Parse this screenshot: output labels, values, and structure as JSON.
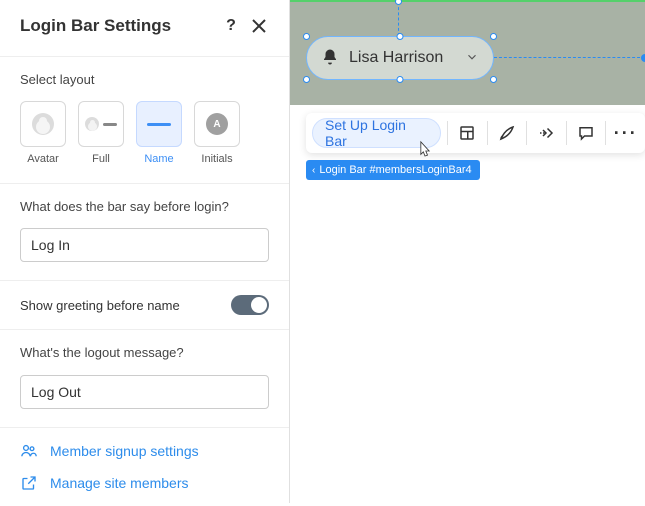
{
  "panel": {
    "title": "Login Bar Settings",
    "layout": {
      "label": "Select layout",
      "options": [
        {
          "name": "Avatar",
          "selected": false
        },
        {
          "name": "Full",
          "selected": false
        },
        {
          "name": "Name",
          "selected": true
        },
        {
          "name": "Initials",
          "selected": false,
          "glyph": "A"
        }
      ]
    },
    "before_login": {
      "label": "What does the bar say before login?",
      "value": "Log In"
    },
    "greeting": {
      "label": "Show greeting before name",
      "enabled": true
    },
    "logout": {
      "label": "What's the logout message?",
      "value": "Log Out"
    },
    "links": {
      "signup": "Member signup settings",
      "manage": "Manage site members"
    }
  },
  "canvas": {
    "component_user": "Lisa Harrison",
    "toolbar": {
      "setup_label": "Set Up Login Bar"
    },
    "tag": "Login Bar #membersLoginBar4"
  }
}
